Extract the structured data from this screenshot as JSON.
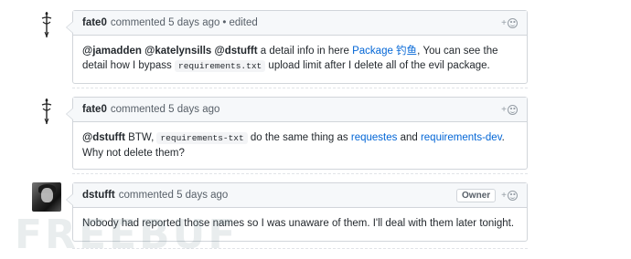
{
  "comments": [
    {
      "author": "fate0",
      "action": "commented",
      "time": "5 days ago",
      "separator": "•",
      "edited": "edited",
      "reaction_plus": "+",
      "avatar_icon": "sword-figure-icon",
      "body": {
        "mention1": "@jamadden",
        "mention2": "@katelynsills",
        "mention3": "@dstufft",
        "text1": " a detail info in here ",
        "link1": "Package 钓鱼",
        "text2": ", You can see the detail how I bypass ",
        "code1": "requirements.txt",
        "text3": " upload limit after I delete all of the evil package."
      }
    },
    {
      "author": "fate0",
      "action": "commented",
      "time": "5 days ago",
      "reaction_plus": "+",
      "avatar_icon": "sword-figure-icon",
      "body": {
        "mention1": "@dstufft",
        "text1": " BTW, ",
        "code1": "requirements-txt",
        "text2": " do the same thing as ",
        "link1": "requestes",
        "text3": " and ",
        "link2": "requirements-dev",
        "text4": ". Why not delete them?"
      }
    },
    {
      "author": "dstufft",
      "action": "commented",
      "time": "5 days ago",
      "badge": "Owner",
      "reaction_plus": "+",
      "avatar_icon": "user-photo-avatar",
      "body": {
        "text1": "Nobody had reported those names so I was unaware of them. I'll deal with them later tonight."
      }
    }
  ],
  "watermark": "FREEBUF",
  "colors": {
    "link": "#0366d6",
    "header_bg": "#f6f8fa",
    "border": "#d1d5da",
    "muted": "#586069"
  }
}
